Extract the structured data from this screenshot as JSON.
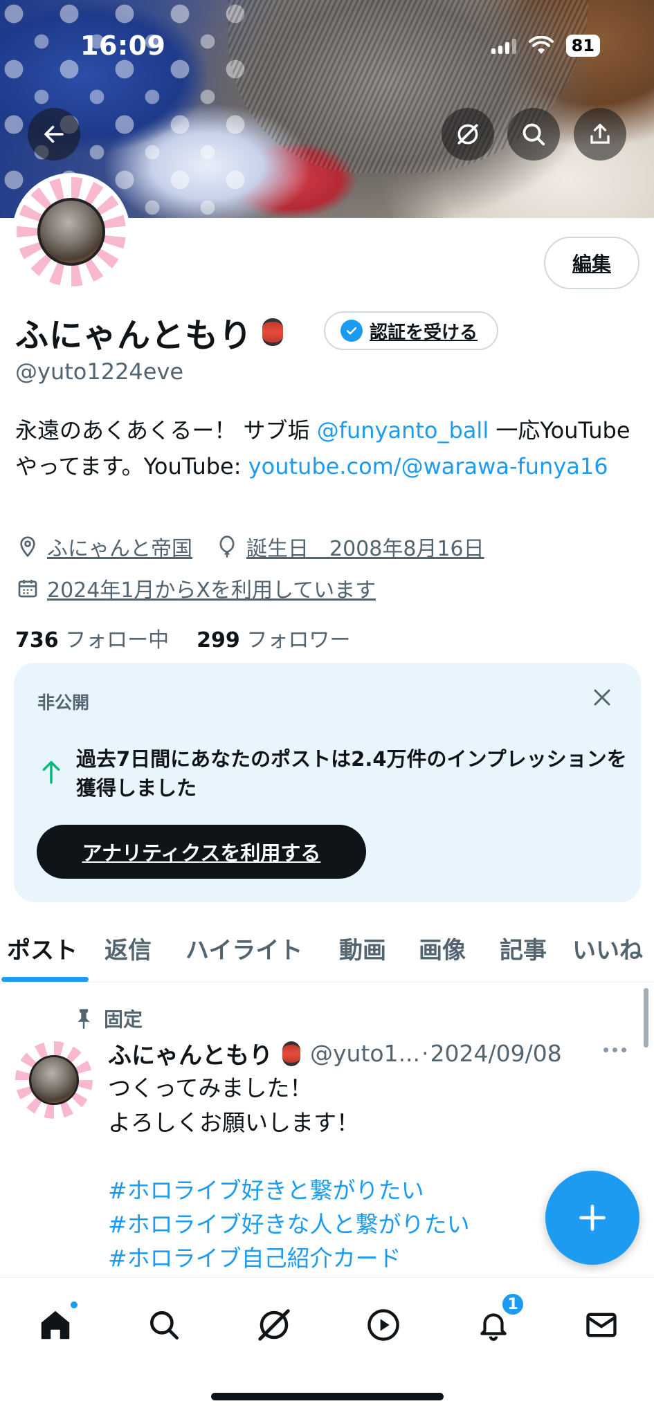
{
  "status_bar": {
    "time": "16:09",
    "battery": "81"
  },
  "profile": {
    "edit_label": "編集",
    "display_name": "ふにゃんともり",
    "verify_label": "認証を受ける",
    "handle": "@yuto1224eve",
    "bio": {
      "part1": "永遠のあくあくるー！ サブ垢 ",
      "mention": "@funyanto_ball",
      "part2": " 一応YouTubeやってます。YouTube: ",
      "link": "youtube.com/@warawa-funya16"
    },
    "location": "ふにゃんと帝国",
    "birthday": "誕生日　2008年8月16日",
    "joined": "2024年1月からXを利用しています",
    "following_count": "736",
    "following_label": "フォロー中",
    "followers_count": "299",
    "followers_label": "フォロワー"
  },
  "analytics_card": {
    "label": "非公開",
    "text": "過去7日間にあなたのポストは2.4万件のインプレッションを獲得しました",
    "button": "アナリティクスを利用する"
  },
  "tabs": [
    "ポスト",
    "返信",
    "ハイライト",
    "動画",
    "画像",
    "記事",
    "いいね"
  ],
  "post": {
    "pinned_label": "固定",
    "name": "ふにゃんともり",
    "handle": "@yuto1...",
    "date": "2024/09/08",
    "line1": "つくってみました！",
    "line2": "よろしくお願いします！",
    "tags": [
      "#ホロライブ好きと繋がりたい",
      "#ホロライブ好きな人と繋がりたい",
      "#ホロライブ自己紹介カード"
    ]
  },
  "bottom_nav": {
    "notifications_badge": "1"
  },
  "colors": {
    "accent": "#1d9bf0",
    "text": "#0f1419",
    "secondary": "#536471",
    "card_bg": "#e8f5fd"
  },
  "icons": [
    "back-arrow-icon",
    "grok-icon",
    "search-icon",
    "share-icon",
    "verified-badge-icon",
    "location-icon",
    "balloon-icon",
    "calendar-icon",
    "close-icon",
    "arrow-up-icon",
    "pin-icon",
    "more-icon",
    "plus-icon",
    "home-icon",
    "play-icon",
    "bell-icon",
    "mail-icon"
  ]
}
